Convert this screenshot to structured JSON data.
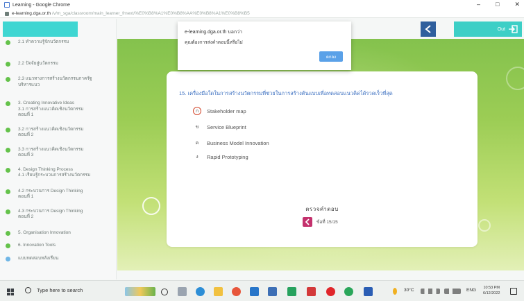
{
  "browser": {
    "title": "Learning - Google Chrome",
    "url_host": "e-learning.dga.or.th",
    "url_path": "/v/m_sga/classroom/main_learner_frnext/%E0%B8%A1%E0%B8%AA%E0%B8%A1%E0%B8%B5",
    "controls": [
      "–",
      "□",
      "✕"
    ]
  },
  "sidebar": {
    "items": [
      {
        "lines": [
          "2.1 ทำความรู้จักนวัตกรรม"
        ],
        "color": "green"
      },
      {
        "lines": [
          "2.2 ปัจจัยสู่นวัตกรรม"
        ],
        "color": "green"
      },
      {
        "lines": [
          "2.3 แนวทางการสร้างนวัตกรรมภาครัฐ",
          "บริหารแนว"
        ],
        "color": "green"
      },
      {
        "lines": [
          "3. Creating Innovative Ideas",
          "3.1 การสร้างแนวคิดเชิงนวัตกรรม",
          "ตอนที่ 1"
        ],
        "color": "green"
      },
      {
        "lines": [
          "3.2 การสร้างแนวคิดเชิงนวัตกรรม",
          "ตอนที่ 2"
        ],
        "color": "green"
      },
      {
        "lines": [
          "3.3 การสร้างแนวคิดเชิงนวัตกรรม",
          "ตอนที่ 3"
        ],
        "color": "green"
      },
      {
        "lines": [
          "4. Design Thinking Process",
          "4.1 เรียนรู้กระบวนการสร้างนวัตกรรม"
        ],
        "color": "green"
      },
      {
        "lines": [
          "4.2 กระบวนการ Design Thinking",
          "ตอนที่ 1"
        ],
        "color": "green"
      },
      {
        "lines": [
          "4.3 กระบวนการ Design Thinking",
          "ตอนที่ 2"
        ],
        "color": "green"
      },
      {
        "lines": [
          "5. Organisation Innovation"
        ],
        "color": "green"
      },
      {
        "lines": [
          "6. Innovation Tools"
        ],
        "color": "green"
      },
      {
        "lines": [
          "แบบทดสอบหลังเรียน"
        ],
        "color": "blue"
      }
    ]
  },
  "header": {
    "exit_label": "Out"
  },
  "popup": {
    "host": "e-learning.dga.or.th บอกว่า",
    "message": "คุณต้องการส่งคำตอบนี้หรือไม่",
    "ok_label": "ตกลง"
  },
  "quiz": {
    "question": "15. เครื่องมือใดในการสร้างนวัตกรรมที่ช่วยในการสร้างต้นแบบเพื่อทดสอบแนวคิดได้รวดเร็วที่สุด",
    "options": [
      {
        "letter": "ก",
        "text": "Stakeholder map",
        "selected": true
      },
      {
        "letter": "ข",
        "text": "Service Blueprint",
        "selected": false
      },
      {
        "letter": "ค",
        "text": "Business Model Innovation",
        "selected": false
      },
      {
        "letter": "ง",
        "text": "Rapid Prototyping",
        "selected": false
      }
    ],
    "check_label": "ตรวจคำตอบ",
    "page_label": "ข้อที่ 15/15"
  },
  "taskbar": {
    "search_placeholder": "Type here to search",
    "weather": "30°C",
    "lang": "ENG",
    "time": "10:53 PM",
    "date": "6/12/2022"
  }
}
